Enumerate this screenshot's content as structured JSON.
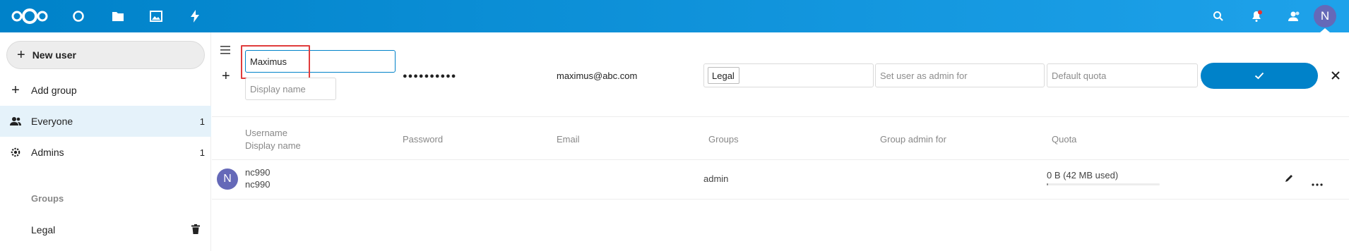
{
  "colors": {
    "accent": "#0082c9",
    "header_gradient_end": "#1ea2ea",
    "avatar": "#6569b8",
    "highlight_box": "#e03c3c"
  },
  "header": {
    "apps": [
      "nextcloud-logo",
      "dashboard-icon",
      "files-icon",
      "photos-icon",
      "activity-icon"
    ],
    "right_icons": [
      "search-icon",
      "notifications-icon",
      "contacts-icon"
    ],
    "avatar_letter": "N"
  },
  "sidebar": {
    "new_user_label": "New user",
    "add_group_label": "Add group",
    "items": [
      {
        "label": "Everyone",
        "count": "1",
        "icon": "user-group-icon"
      },
      {
        "label": "Admins",
        "count": "1",
        "icon": "admin-gear-icon"
      }
    ],
    "groups_caption": "Groups",
    "groups": [
      {
        "label": "Legal",
        "icon": "trash-icon"
      }
    ]
  },
  "new_user_form": {
    "username_value": "Maximus",
    "display_name_placeholder": "Display name",
    "password_masked": "●●●●●●●●●●",
    "email_value": "maximus@abc.com",
    "groups_tag": "Legal",
    "group_admin_placeholder": "Set user as admin for",
    "quota_placeholder": "Default quota"
  },
  "table": {
    "headers": {
      "username": "Username",
      "display_name": "Display name",
      "password": "Password",
      "email": "Email",
      "groups": "Groups",
      "group_admin": "Group admin for",
      "quota": "Quota"
    },
    "rows": [
      {
        "avatar_letter": "N",
        "username": "nc990",
        "display_name": "nc990",
        "groups": "admin",
        "quota": "0 B (42 MB used)",
        "quota_used_fraction": 0.01
      }
    ]
  }
}
